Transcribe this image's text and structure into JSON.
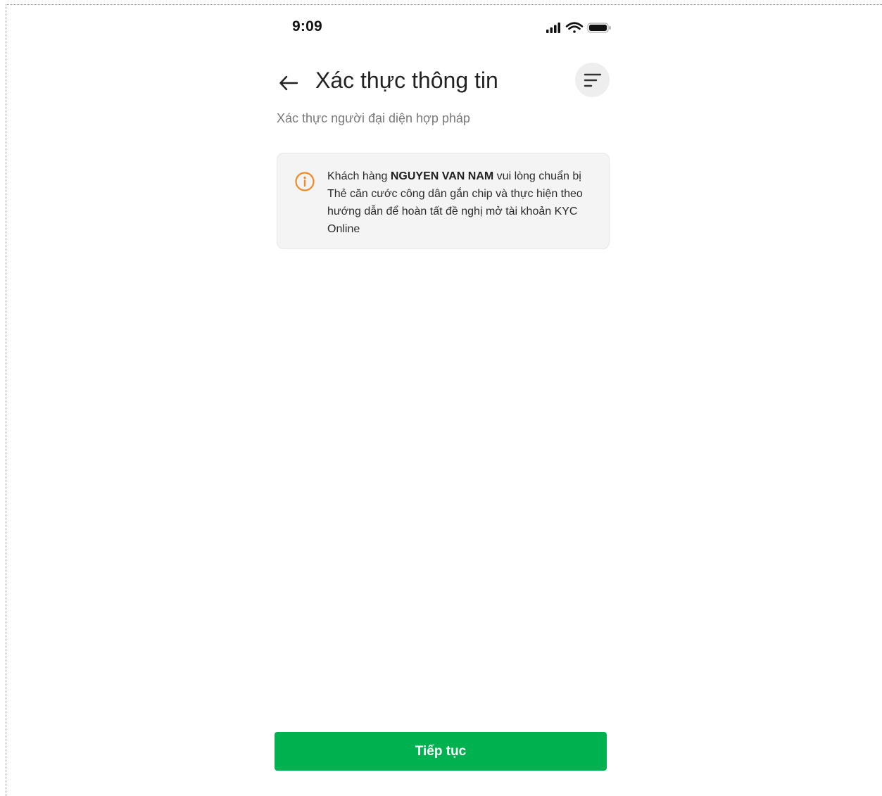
{
  "status_bar": {
    "time": "9:09",
    "icons": [
      "signal-icon",
      "wifi-icon",
      "battery-icon"
    ]
  },
  "header": {
    "back_icon": "arrow-left-icon",
    "title": "Xác thực thông tin",
    "menu_icon": "filter-lines-icon"
  },
  "subtitle": "Xác thực người đại diện hợp pháp",
  "notice": {
    "icon": "info-icon",
    "text_before": "Khách hàng ",
    "customer_name": "NGUYEN VAN NAM",
    "text_after": " vui lòng chuẩn bị Thẻ căn cước công dân gắn chip và thực hiện theo hướng dẫn để hoàn tất đề nghị mở tài khoản KYC Online"
  },
  "actions": {
    "continue_label": "Tiếp tục"
  },
  "colors": {
    "primary": "#00b14f",
    "info_accent": "#f08a24",
    "card_bg": "#f4f4f4",
    "subtitle": "#7a7a7a"
  }
}
